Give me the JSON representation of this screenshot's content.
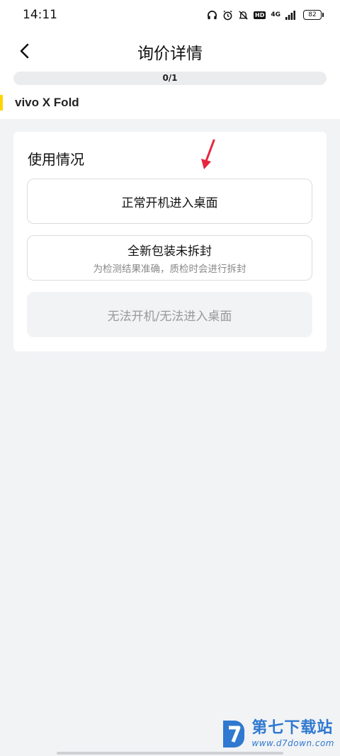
{
  "status_bar": {
    "time": "14:11",
    "network": "4G",
    "hd": "HD",
    "battery": "82"
  },
  "header": {
    "title": "询价详情"
  },
  "progress": {
    "text": "0/1",
    "fraction": 0
  },
  "product": {
    "model": "vivo X Fold"
  },
  "usage_card": {
    "title": "使用情况",
    "options": [
      {
        "label": "正常开机进入桌面",
        "sub": ""
      },
      {
        "label": "全新包装未拆封",
        "sub": "为检测结果准确，质检时会进行拆封"
      },
      {
        "label": "无法开机/无法进入桌面",
        "sub": ""
      }
    ]
  },
  "watermark": {
    "title": "第七下载站",
    "url": "www.d7down.com"
  },
  "colors": {
    "accent": "#ffd400",
    "arrow": "#e8253f",
    "watermark": "#2f79d0"
  }
}
